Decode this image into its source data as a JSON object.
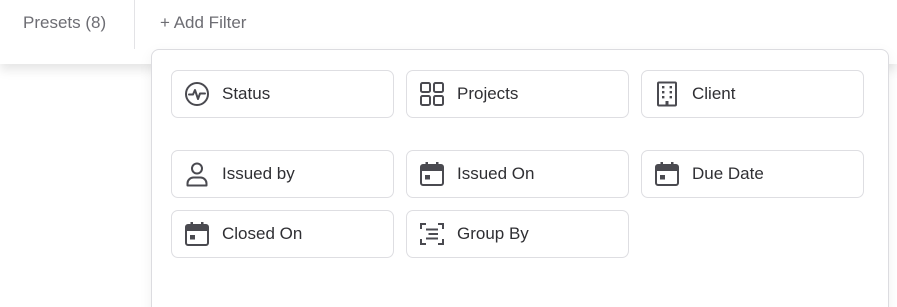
{
  "filter_bar": {
    "presets_label": "Presets (8)",
    "add_filter_label": "+ Add Filter"
  },
  "filter_menu": {
    "options": [
      {
        "label": "Status",
        "icon": "activity-icon"
      },
      {
        "label": "Projects",
        "icon": "grid-icon"
      },
      {
        "label": "Client",
        "icon": "building-icon"
      },
      {
        "label": "Issued by",
        "icon": "user-icon"
      },
      {
        "label": "Issued On",
        "icon": "calendar-icon"
      },
      {
        "label": "Due Date",
        "icon": "calendar-icon"
      },
      {
        "label": "Closed On",
        "icon": "calendar-icon"
      },
      {
        "label": "Group By",
        "icon": "group-by-icon"
      }
    ]
  },
  "colors": {
    "muted_text": "#6d6d73",
    "option_text": "#2f2f33",
    "icon_stroke": "#4a4a50",
    "border": "#dedee2"
  }
}
